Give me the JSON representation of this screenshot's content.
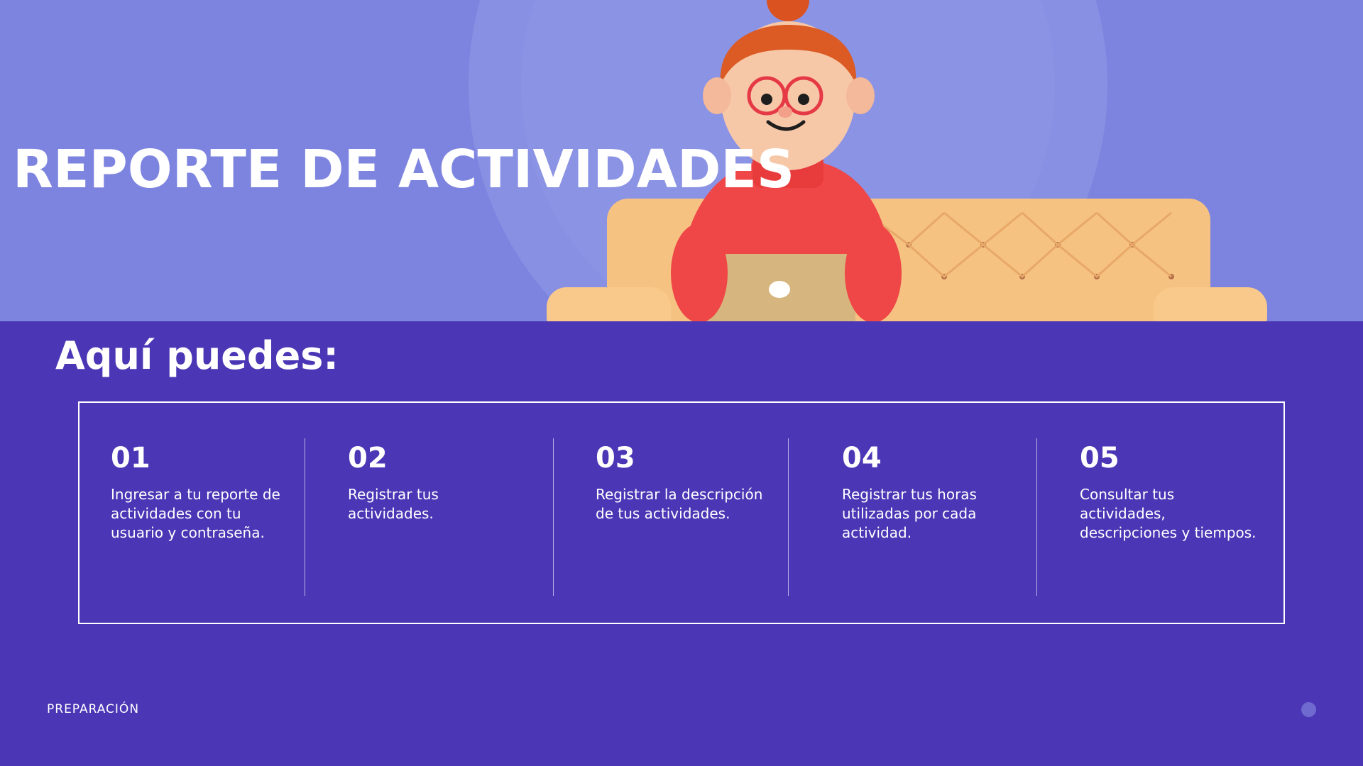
{
  "hero": {
    "title": "REPORTE DE ACTIVIDADES"
  },
  "section": {
    "heading": "Aquí puedes:"
  },
  "steps": [
    {
      "number": "01",
      "text": "Ingresar a tu reporte de actividades con tu usuario y contraseña."
    },
    {
      "number": "02",
      "text": "Registrar tus actividades."
    },
    {
      "number": "03",
      "text": "Registrar la descripción de tus actividades."
    },
    {
      "number": "04",
      "text": "Registrar tus horas utilizadas por cada actividad."
    },
    {
      "number": "05",
      "text": "Consultar tus actividades, descripciones y tiempos."
    }
  ],
  "footer": {
    "label": "PREPARACIÓN"
  },
  "colors": {
    "hero_background": "#7d84df",
    "page_background": "#4b37b5",
    "text": "#ffffff"
  }
}
